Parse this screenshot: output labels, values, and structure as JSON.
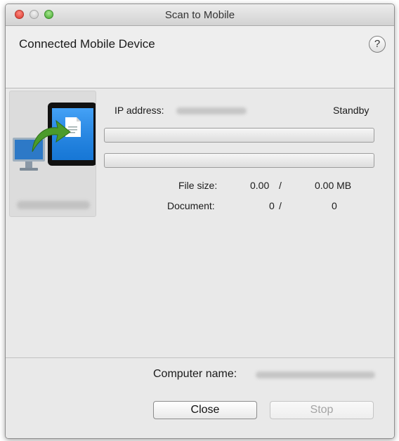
{
  "window": {
    "title": "Scan to Mobile"
  },
  "header": {
    "title": "Connected Mobile Device",
    "help_label": "?"
  },
  "device": {
    "icon": "computer-to-mobile-transfer-icon"
  },
  "status": {
    "ip_label": "IP address:",
    "state": "Standby",
    "progress_1": 0,
    "progress_2": 0
  },
  "stats": {
    "file_size_label": "File size:",
    "file_size_done": "0.00",
    "file_size_sep": "/",
    "file_size_total": "0.00 MB",
    "document_label": "Document:",
    "document_done": "0",
    "document_sep": "/",
    "document_total": "0"
  },
  "footer": {
    "computer_name_label": "Computer name:",
    "close_label": "Close",
    "stop_label": "Stop"
  },
  "colors": {
    "accent": "#1e87ea",
    "arrow": "#4c9b2b"
  }
}
